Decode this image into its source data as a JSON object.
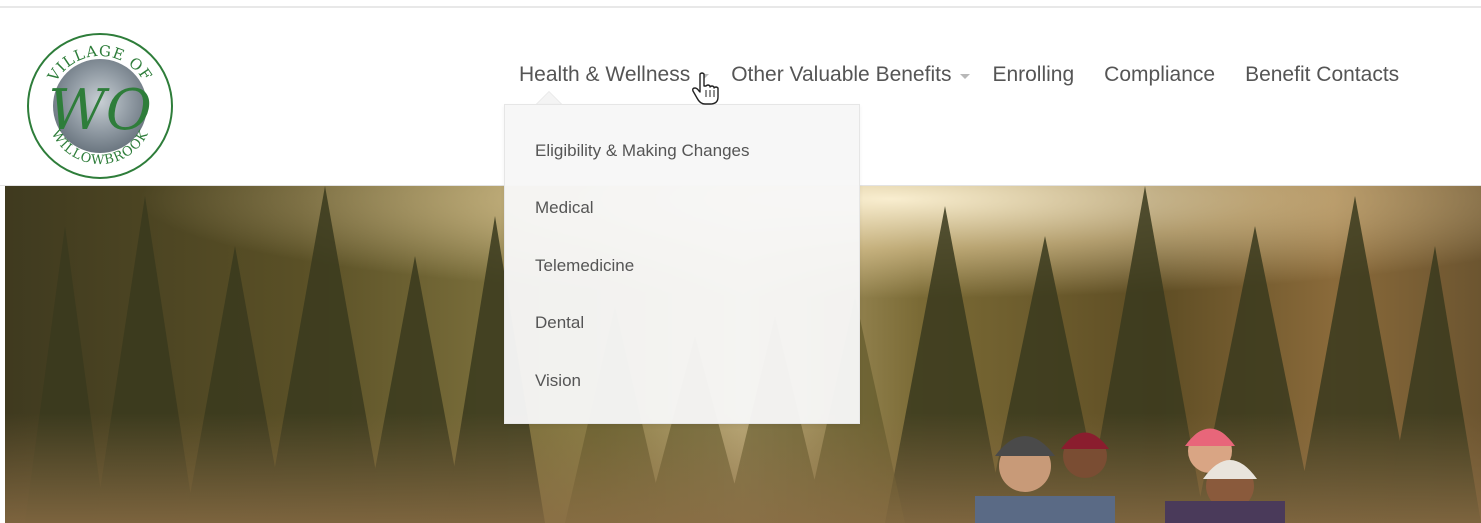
{
  "logo": {
    "top_text": "VILLAGE OF",
    "bottom_text": "WILLOWBROOK",
    "monogram": "WO"
  },
  "nav": {
    "items": [
      {
        "label": "Health & Wellness",
        "has_dropdown": true
      },
      {
        "label": "Other Valuable Benefits",
        "has_dropdown": true
      },
      {
        "label": "Enrolling",
        "has_dropdown": false
      },
      {
        "label": "Compliance",
        "has_dropdown": false
      },
      {
        "label": "Benefit Contacts",
        "has_dropdown": false
      }
    ]
  },
  "dropdown": {
    "items": [
      "Eligibility & Making Changes",
      "Medical",
      "Telemedicine",
      "Dental",
      "Vision"
    ]
  },
  "colors": {
    "nav_text": "#555555",
    "logo_green": "#2e7d3a",
    "logo_silver": "#9aa3ab"
  },
  "icons": {
    "cursor": "hand-pointer-icon",
    "caret": "caret-down-icon"
  }
}
